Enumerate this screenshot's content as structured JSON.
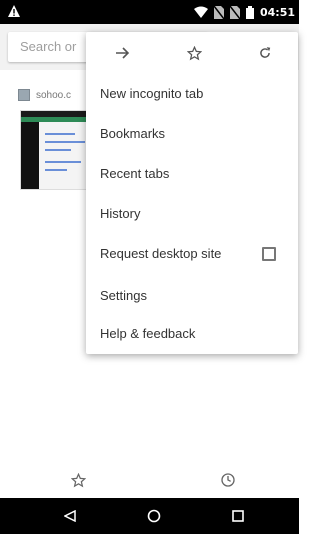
{
  "status_bar": {
    "time": "04:51",
    "icons": [
      "warning-icon",
      "wifi-icon",
      "no-sim-icon",
      "no-sim-icon",
      "battery-icon"
    ]
  },
  "omnibox": {
    "placeholder": "Search or"
  },
  "recent_tile": {
    "title": "sohoo.c"
  },
  "menu": {
    "top_icons": [
      "forward-arrow-icon",
      "bookmark-star-icon",
      "reload-icon"
    ],
    "items": [
      {
        "label": "New incognito tab"
      },
      {
        "label": "Bookmarks"
      },
      {
        "label": "Recent tabs"
      },
      {
        "label": "History"
      },
      {
        "label": "Request desktop site",
        "checkbox": false
      },
      {
        "label": "Settings"
      },
      {
        "label": "Help & feedback"
      }
    ]
  },
  "bottom_toolbar": {
    "icons": [
      "bookmark-star-icon",
      "history-clock-icon"
    ]
  },
  "nav_bar": {
    "icons": [
      "back-icon",
      "home-icon",
      "recents-icon"
    ]
  }
}
